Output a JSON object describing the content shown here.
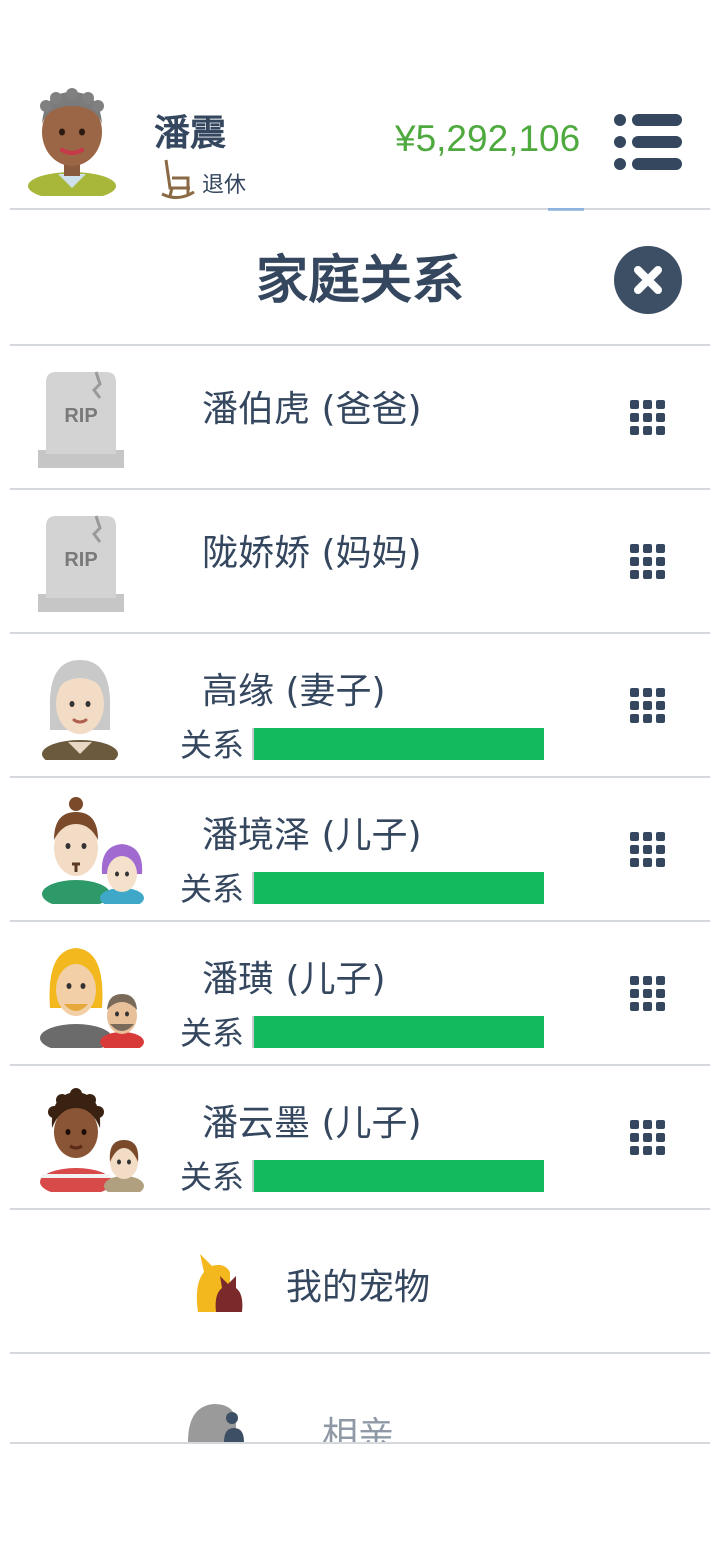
{
  "header": {
    "player_name": "潘震",
    "status": "退休",
    "money": "¥5,292,106"
  },
  "panel": {
    "title": "家庭关系"
  },
  "relationships": [
    {
      "name": "潘伯虎 (爸爸)",
      "deceased": true,
      "icon": "tombstone-icon",
      "tombstone_text": "RIP"
    },
    {
      "name": "陇娇娇 (妈妈)",
      "deceased": true,
      "icon": "tombstone-icon",
      "tombstone_text": "RIP"
    },
    {
      "name": "高缘 (妻子)",
      "deceased": false,
      "icon": "elder-woman-avatar",
      "relation_label": "关系",
      "relation_level": 1.0
    },
    {
      "name": "潘境泽 (儿子)",
      "deceased": false,
      "icon": "son-with-partner-avatar",
      "relation_label": "关系",
      "relation_level": 1.0
    },
    {
      "name": "潘璜 (儿子)",
      "deceased": false,
      "icon": "son-with-partner-avatar",
      "relation_label": "关系",
      "relation_level": 1.0
    },
    {
      "name": "潘云墨 (儿子)",
      "deceased": false,
      "icon": "son-with-partner-avatar",
      "relation_label": "关系",
      "relation_level": 1.0
    }
  ],
  "pets": {
    "label": "我的宠物",
    "icon": "pets-icon"
  },
  "blind_date": {
    "label": "相亲",
    "icon": "blind-date-icon"
  },
  "colors": {
    "money": "#4ea93e",
    "relationship_bar": "#13ba5e",
    "text": "#34475f",
    "close_button": "#3d4f65"
  }
}
